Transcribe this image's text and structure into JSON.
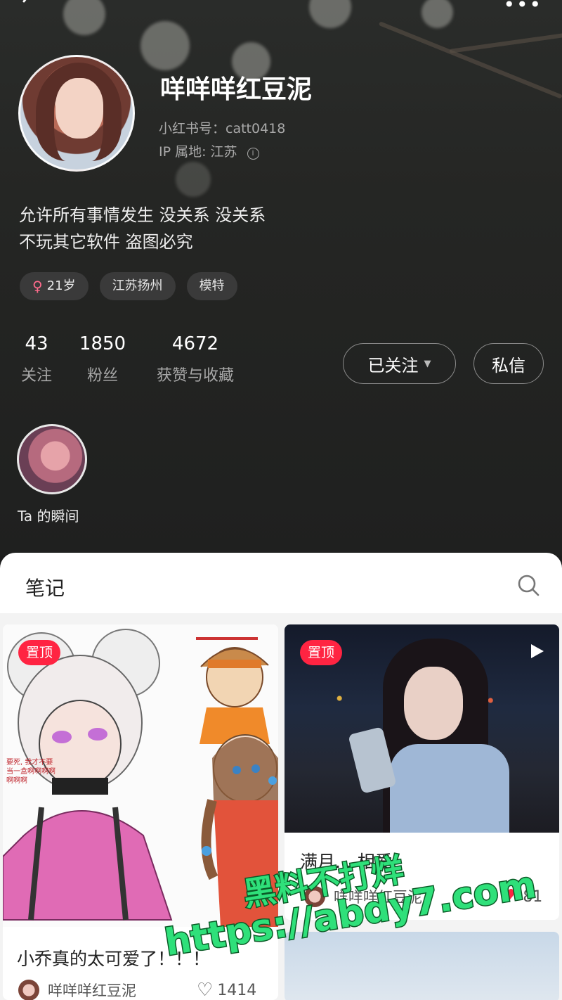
{
  "profile": {
    "name": "咩咩咩红豆泥",
    "red_id": "小红书号：catt0418",
    "ip": "IP 属地: 江苏",
    "bio_line1": "允许所有事情发生  没关系 没关系",
    "bio_line2": "不玩其它软件 盗图必究",
    "tags": [
      {
        "icon": "female-icon",
        "label": "21岁"
      },
      {
        "label": "江苏扬州"
      },
      {
        "label": "模特"
      }
    ],
    "stats": [
      {
        "value": "43",
        "label": "关注"
      },
      {
        "value": "1850",
        "label": "粉丝"
      },
      {
        "value": "4672",
        "label": "获赞与收藏"
      }
    ],
    "follow_label": "已关注",
    "message_label": "私信",
    "moments_label": "Ta 的瞬间"
  },
  "notes": {
    "tab_label": "笔记",
    "cards": [
      {
        "pin": "置顶",
        "comic_text": "要死, 我才不要当一盒啊啊啊啊啊啊啊",
        "title": "小乔真的太可爱了！！！",
        "author": "咩咩咩红豆泥",
        "likes": "1414"
      },
      {
        "pin": "置顶",
        "title": "满月... 相爱",
        "author": "咩咩咩红豆泥",
        "likes": "81"
      }
    ]
  },
  "watermark": {
    "line1": "黑料不打烊",
    "line2": "https://abdy7.com"
  },
  "colors": {
    "accent": "#ff2442",
    "header_bg": "#252624",
    "watermark": "#2fe07a"
  }
}
